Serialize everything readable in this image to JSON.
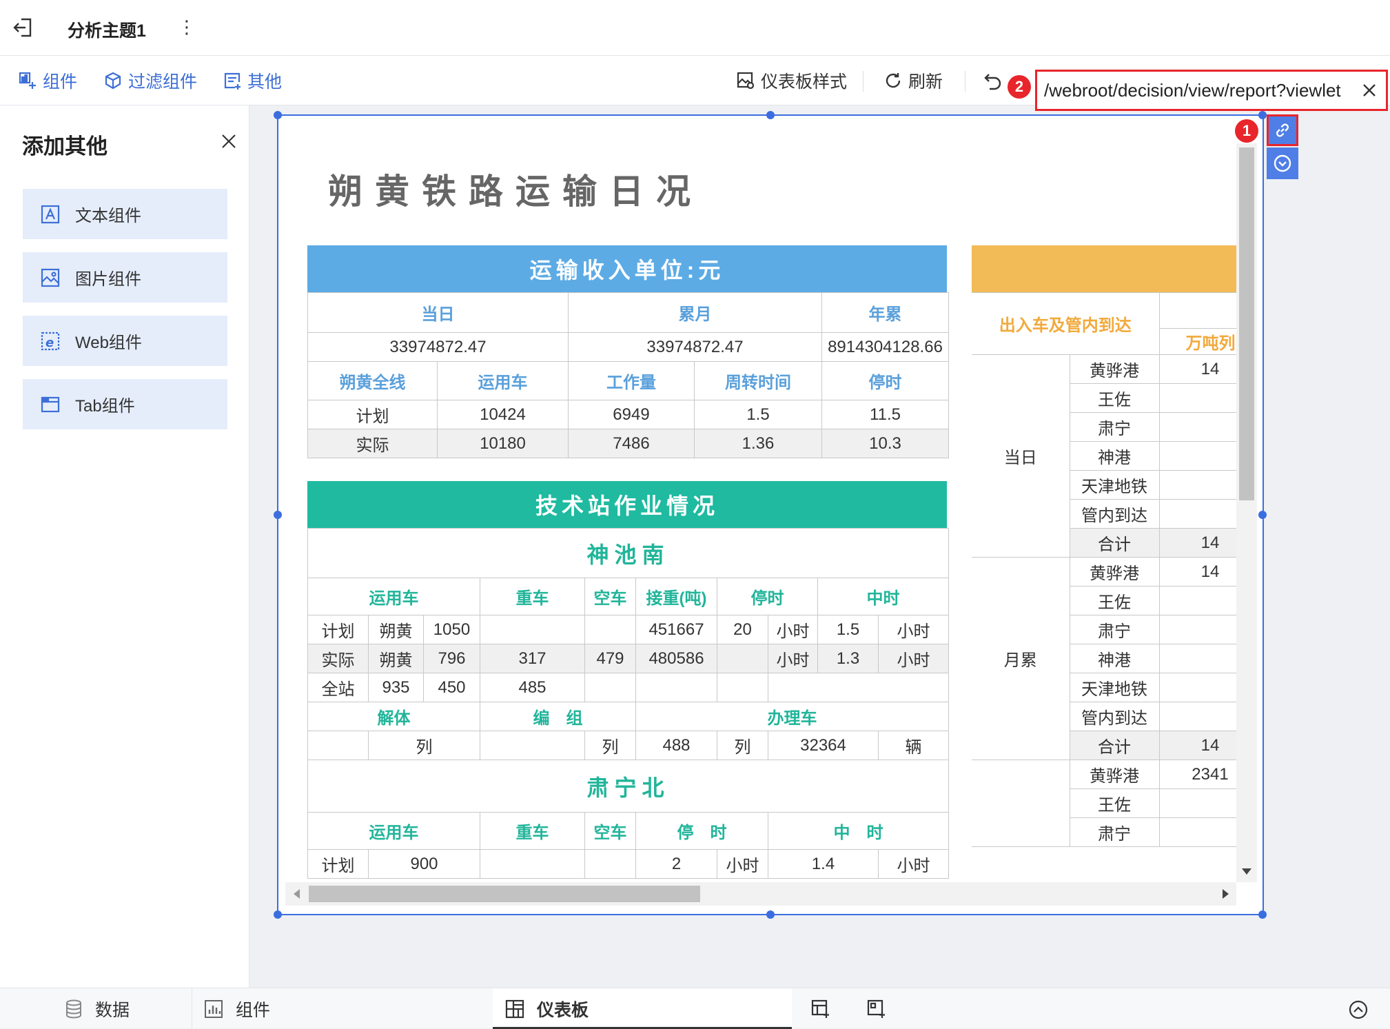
{
  "topbar": {
    "title": "分析主题1",
    "more": "⋮"
  },
  "toolbar": {
    "components": "组件",
    "filter_components": "过滤组件",
    "other": "其他",
    "dashboard_style": "仪表板样式",
    "refresh": "刷新"
  },
  "url_editor": {
    "value": "/webroot/decision/view/report?viewlet",
    "badge": "2"
  },
  "link_badge": "1",
  "left_panel": {
    "title": "添加其他",
    "items": [
      "文本组件",
      "图片组件",
      "Web组件",
      "Tab组件"
    ]
  },
  "report": {
    "title": "朔黄铁路运输日况",
    "income": {
      "banner": "运输收入单位:元",
      "headers": [
        "当日",
        "累月",
        "年累"
      ],
      "values": [
        "33974872.47",
        "33974872.47",
        "8914304128.66"
      ],
      "headers2": [
        "朔黄全线",
        "运用车",
        "工作量",
        "周转时间",
        "停时"
      ],
      "rows": [
        [
          "计划",
          "10424",
          "6949",
          "1.5",
          "11.5"
        ],
        [
          "实际",
          "10180",
          "7486",
          "1.36",
          "10.3"
        ]
      ]
    },
    "tech": {
      "banner": "技术站作业情况",
      "station1": "神池南",
      "h1": [
        "运用车",
        "重车",
        "空车",
        "接重(吨)",
        "停时",
        "中时"
      ],
      "r1": [
        "计划",
        "朔黄",
        "1050",
        "",
        "",
        "451667",
        "20",
        "小时",
        "1.5",
        "小时"
      ],
      "r2": [
        "实际",
        "朔黄",
        "796",
        "317",
        "479",
        "480586",
        "",
        "小时",
        "1.3",
        "小时"
      ],
      "r3": [
        "全站",
        "935",
        "450",
        "485"
      ],
      "h2": [
        "解体",
        "编　组",
        "办理车"
      ],
      "r4": [
        "",
        "列",
        "",
        "列",
        "488",
        "列",
        "32364",
        "辆"
      ],
      "station2": "肃宁北",
      "h3": [
        "运用车",
        "重车",
        "空车",
        "停　时",
        "中　时"
      ],
      "r5": [
        "计划",
        "900",
        "",
        "",
        "2",
        "小时",
        "1.4",
        "小时"
      ]
    },
    "right": {
      "header": "出入车及管内到达",
      "unit": "万吨列",
      "groups": [
        {
          "name": "当日",
          "rows": [
            [
              "黄骅港",
              "14"
            ],
            [
              "王佐",
              ""
            ],
            [
              "肃宁",
              ""
            ],
            [
              "神港",
              ""
            ],
            [
              "天津地铁",
              ""
            ],
            [
              "管内到达",
              ""
            ],
            [
              "合计",
              "14"
            ]
          ]
        },
        {
          "name": "月累",
          "rows": [
            [
              "黄骅港",
              "14"
            ],
            [
              "王佐",
              ""
            ],
            [
              "肃宁",
              ""
            ],
            [
              "神港",
              ""
            ],
            [
              "天津地铁",
              ""
            ],
            [
              "管内到达",
              ""
            ],
            [
              "合计",
              "14"
            ]
          ]
        },
        {
          "name": "",
          "rows": [
            [
              "黄骅港",
              "2341"
            ],
            [
              "王佐",
              ""
            ],
            [
              "肃宁",
              ""
            ]
          ]
        }
      ]
    }
  },
  "bottombar": {
    "data": "数据",
    "components": "组件",
    "dashboard": "仪表板"
  },
  "colors": {
    "accent": "#3b6de0",
    "blue_banner": "#5cabe5",
    "green_banner": "#1fbaa0",
    "orange_banner": "#f2bb58",
    "highlight": "#e8252b"
  }
}
